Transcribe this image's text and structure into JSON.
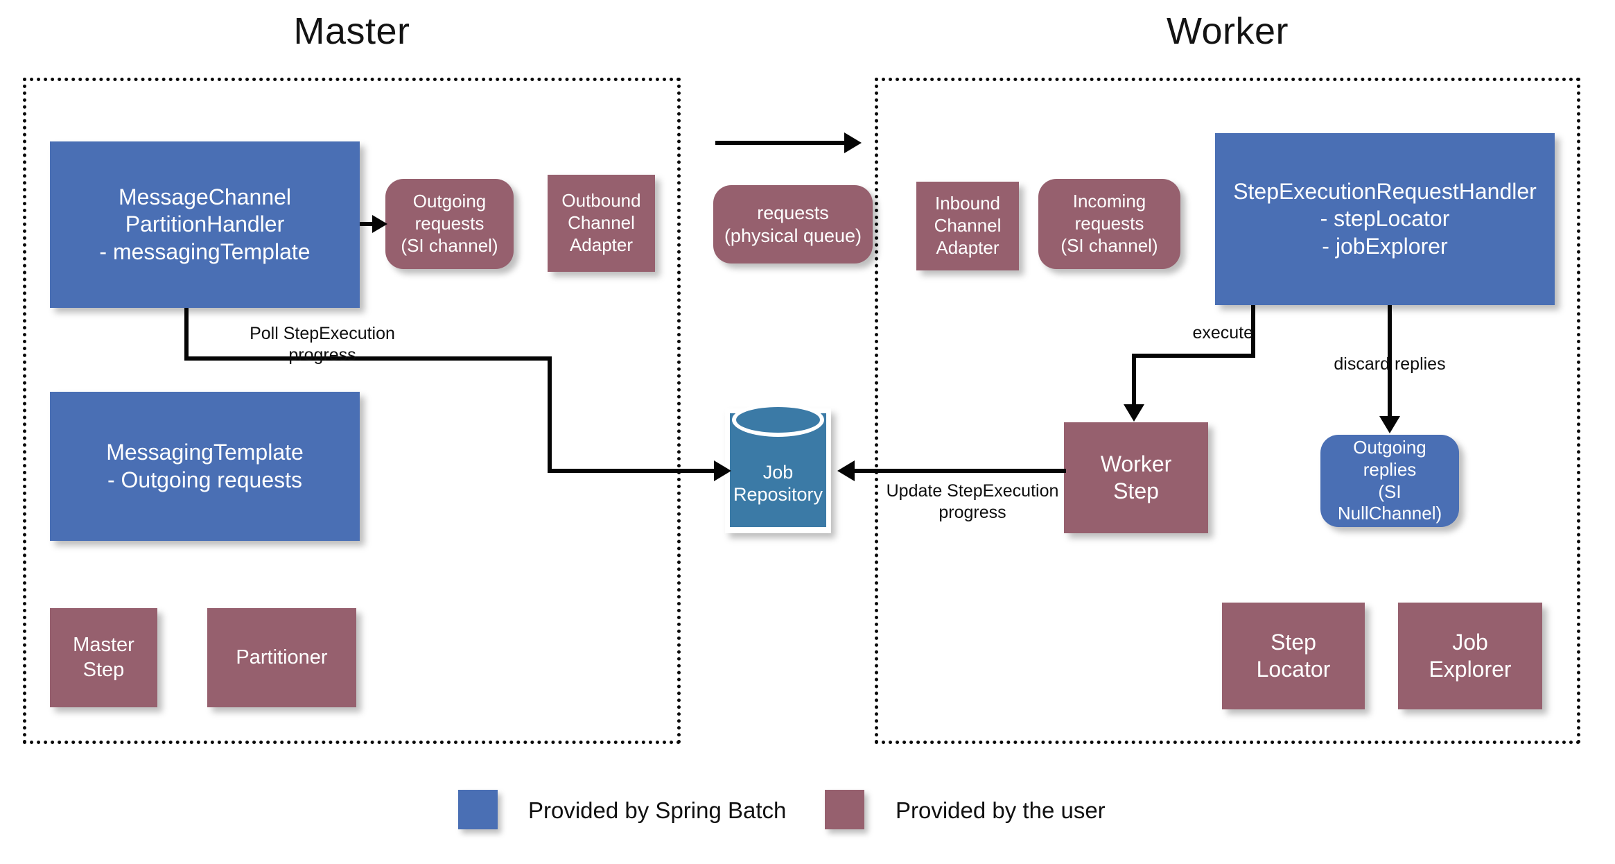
{
  "diagram": {
    "title_master": "Master",
    "title_worker": "Worker",
    "colors": {
      "spring_batch_blue": "#4a6fb4",
      "user_mauve": "#96606e",
      "repository_blue": "#3b7aa6",
      "line": "#050505"
    }
  },
  "master": {
    "nodes": {
      "partition_handler": "MessageChannel\nPartitionHandler\n- messagingTemplate",
      "outgoing_requests_channel": "Outgoing\nrequests\n(SI channel)",
      "outbound_channel_adapter": "Outbound\nChannel\nAdapter",
      "messaging_template": "MessagingTemplate\n- Outgoing requests",
      "master_step": "Master\nStep",
      "partitioner": "Partitioner"
    }
  },
  "middle": {
    "nodes": {
      "requests_physical_queue": "requests\n(physical queue)",
      "job_repository": "Job\nRepository"
    }
  },
  "worker": {
    "nodes": {
      "inbound_channel_adapter": "Inbound\nChannel\nAdapter",
      "incoming_requests_channel": "Incoming\nrequests\n(SI channel)",
      "step_execution_request_handler": "StepExecutionRequestHandler\n- stepLocator\n- jobExplorer",
      "worker_step": "Worker\nStep",
      "outgoing_replies_nullchannel": "Outgoing\nreplies\n(SI NullChannel)",
      "step_locator": "Step\nLocator",
      "job_explorer": "Job\nExplorer"
    }
  },
  "edges": {
    "poll_step_execution": "Poll StepExecution progress",
    "update_step_execution": "Update StepExecution\nprogress",
    "execute": "execute",
    "discard_replies": "discard   replies"
  },
  "legend": {
    "items": [
      {
        "label": "Provided by Spring Batch",
        "color": "#4a6fb4"
      },
      {
        "label": "Provided by the user",
        "color": "#96606e"
      }
    ]
  }
}
